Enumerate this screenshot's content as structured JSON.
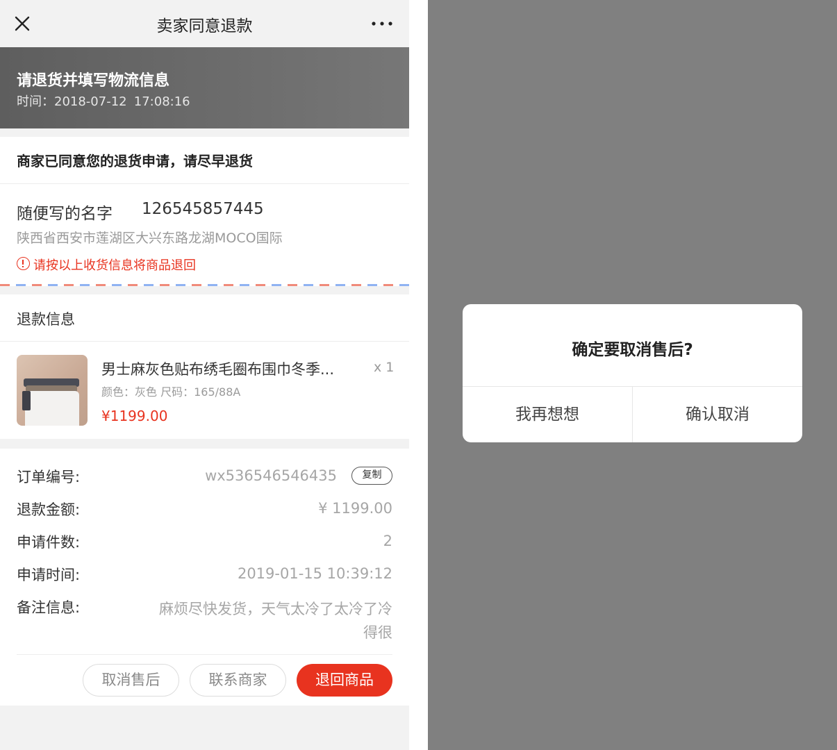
{
  "left_screen": {
    "navbar": {
      "title": "卖家同意退款",
      "close_icon": "close-icon",
      "more_icon": "more-dots-icon"
    },
    "status_banner": {
      "title": "请退货并填写物流信息",
      "time_label": "时间：2018-07-12",
      "time_value": "17:08:16"
    },
    "notice": "商家已同意您的退货申请，请尽早退货",
    "return_address": {
      "name": "随便写的名字",
      "phone": "126545857445",
      "address": "陕西省西安市莲湖区大兴东路龙湖MOCO国际",
      "warning": "请按以上收货信息将商品退回"
    },
    "refund_info": {
      "heading": "退款信息",
      "product": {
        "name": "男士麻灰色贴布绣毛圈布围巾冬季...",
        "quantity": "x 1",
        "spec": "颜色：灰色   尺码：165/88A",
        "price": "¥1199.00"
      }
    },
    "details": {
      "order_no_label": "订单编号:",
      "order_no": "wx536546546435",
      "copy_label": "复制",
      "amount_label": "退款金额:",
      "amount": "¥ 1199.00",
      "count_label": "申请件数:",
      "count": "2",
      "time_label": "申请时间:",
      "time": "2019-01-15 10:39:12",
      "remark_label": "备注信息:",
      "remark": "麻烦尽快发货，天气太冷了太冷了冷得很"
    },
    "actions": {
      "cancel": "取消售后",
      "contact": "联系商家",
      "return_goods": "退回商品"
    }
  },
  "right_screen": {
    "dialog": {
      "title": "确定要取消售后?",
      "cancel_label": "我再想想",
      "confirm_label": "确认取消"
    }
  },
  "colors": {
    "accent_red": "#e8331f",
    "banner_gray": "#6a6a6a",
    "overlay_gray": "#808080"
  }
}
